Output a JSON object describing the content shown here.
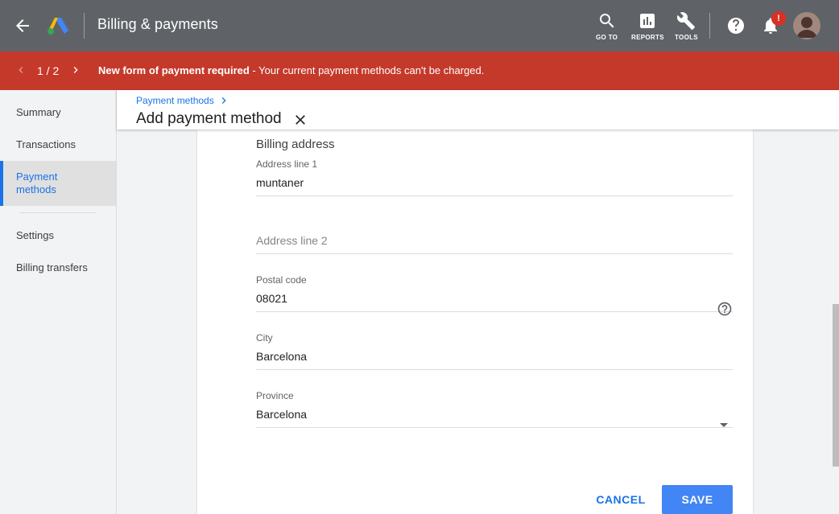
{
  "topbar": {
    "title": "Billing & payments",
    "goto_label": "GO TO",
    "reports_label": "REPORTS",
    "tools_label": "TOOLS",
    "notification_badge": "!"
  },
  "alert": {
    "pager": "1 / 2",
    "message_bold": "New form of payment required",
    "message_rest": " - Your current payment methods can't be charged."
  },
  "sidebar": {
    "items": [
      {
        "label": "Summary"
      },
      {
        "label": "Transactions"
      },
      {
        "label": "Payment methods"
      },
      {
        "label": "Settings"
      },
      {
        "label": "Billing transfers"
      }
    ]
  },
  "header": {
    "breadcrumb": "Payment methods",
    "title": "Add payment method"
  },
  "form": {
    "section_title": "Billing address",
    "address1": {
      "label": "Address line 1",
      "value": "muntaner"
    },
    "address2": {
      "placeholder": "Address line 2",
      "value": ""
    },
    "postal": {
      "label": "Postal code",
      "value": "08021"
    },
    "city": {
      "label": "City",
      "value": "Barcelona"
    },
    "province": {
      "label": "Province",
      "value": "Barcelona"
    }
  },
  "actions": {
    "cancel_label": "CANCEL",
    "save_label": "SAVE"
  },
  "colors": {
    "topbar": "#5f6368",
    "alert": "#c5392b",
    "accent": "#1a73e8",
    "save": "#4285f4"
  }
}
